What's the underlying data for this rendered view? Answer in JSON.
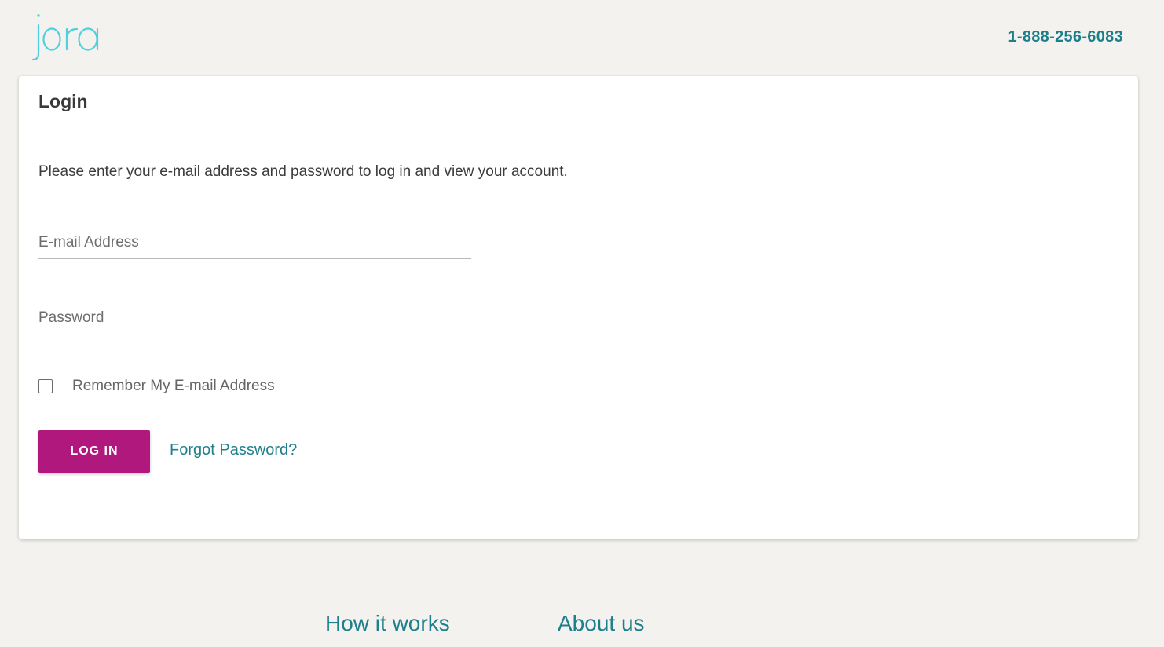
{
  "header": {
    "logo_text": "jora",
    "phone": "1-888-256-6083"
  },
  "login": {
    "title": "Login",
    "intro": "Please enter your e-mail address and password to log in and view your account.",
    "email_placeholder": "E-mail Address",
    "email_value": "",
    "password_placeholder": "Password",
    "password_value": "",
    "remember_label": "Remember My E-mail Address",
    "remember_checked": false,
    "login_button": "LOG IN",
    "forgot_link": "Forgot Password?"
  },
  "footer": {
    "links": [
      "How it works",
      "About us"
    ]
  },
  "colors": {
    "background": "#f4f2ee",
    "accent_teal": "#1e7f8c",
    "logo": "#4fd0de",
    "login_button": "#b0187e"
  }
}
